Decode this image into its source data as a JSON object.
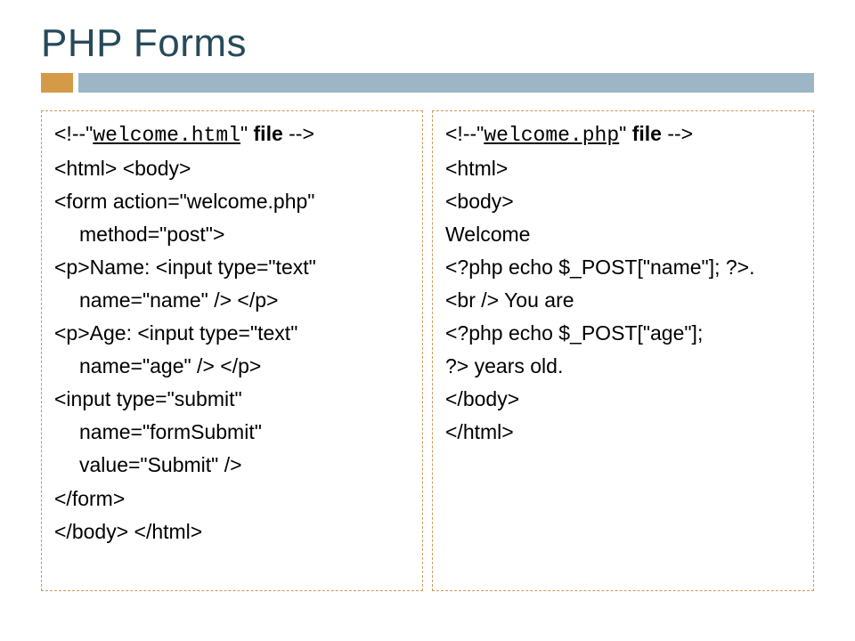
{
  "title": "PHP Forms",
  "left": {
    "comment_open": "<!--\"",
    "comment_file": "welcome.html",
    "comment_mid": "\" ",
    "comment_bold": "file ",
    "comment_close": "-->",
    "l1": "<html> <body>",
    "l2a": "<form action=\"welcome.php\"",
    "l2b": "method=\"post\">",
    "l3a": "<p>Name: <input type=\"text\"",
    "l3b": "name=\"name\" /> </p>",
    "l4a": "<p>Age: <input type=\"text\"",
    "l4b": "name=\"age\" /> </p>",
    "l5a": "<input type=\"submit\"",
    "l5b": "name=\"formSubmit\"",
    "l5c": "value=\"Submit\" />",
    "l6": "</form>",
    "l7": "</body> </html>"
  },
  "right": {
    "comment_open": "<!--\"",
    "comment_file": "welcome.php",
    "comment_mid": "\" ",
    "comment_bold": "file ",
    "comment_close": "-->",
    "r1": "<html>",
    "r2": "<body>",
    "r3": "Welcome",
    "r4": "<?php echo $_POST[\"name\"]; ?>.",
    "r5": "<br /> You are",
    "r6": "<?php echo $_POST[\"age\"];",
    "r7": "?> years old.",
    "r8": "</body>",
    "r9": "</html>"
  }
}
